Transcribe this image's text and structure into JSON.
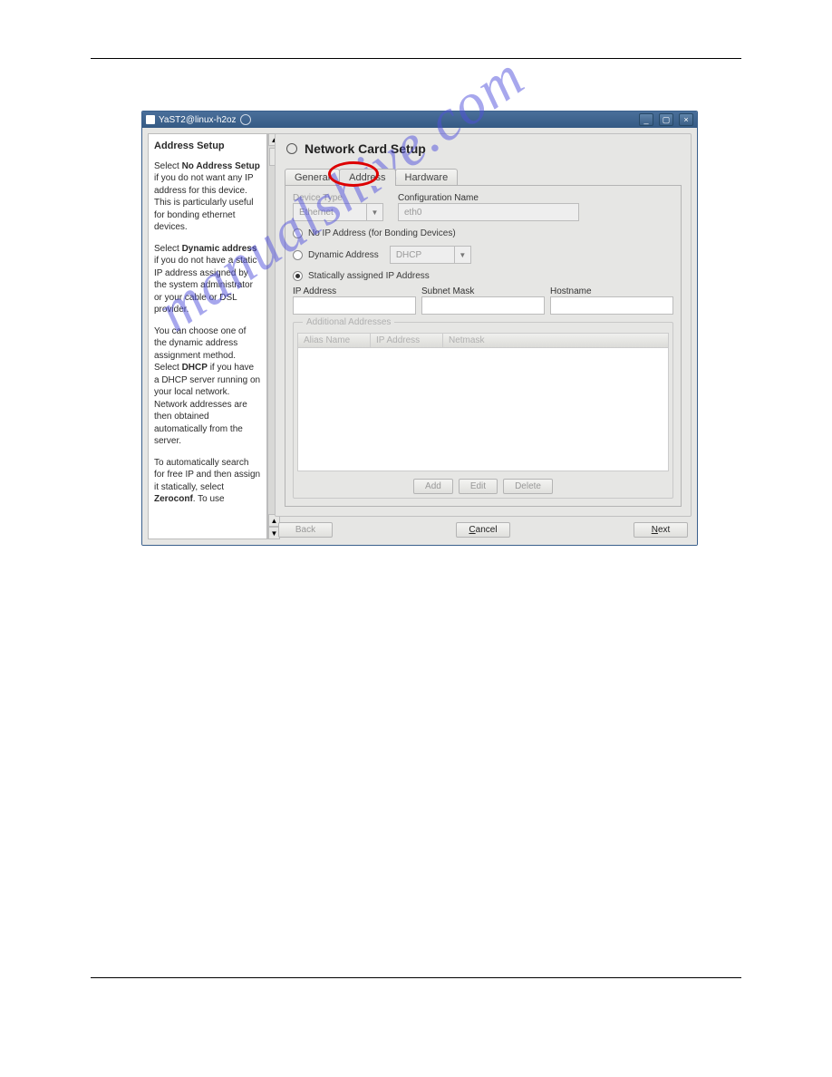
{
  "window": {
    "title": "YaST2@linux-h2oz"
  },
  "sidebar": {
    "heading": "Address Setup",
    "p1_a": "Select ",
    "p1_b": "No Address Setup",
    "p1_c": " if you do not want any IP address for this device. This is particularly useful for bonding ethernet devices.",
    "p2_a": "Select ",
    "p2_b": "Dynamic address",
    "p2_c": " if you do not have a static IP address assigned by the system administrator or your cable or DSL provider.",
    "p3_a": "You can choose one of the dynamic address assignment method. Select ",
    "p3_b": "DHCP",
    "p3_c": " if you have a DHCP server running on your local network. Network addresses are then obtained automatically from the server.",
    "p4_a": "To automatically search for free IP and then assign it statically, select ",
    "p4_b": "Zeroconf",
    "p4_c": ". To use"
  },
  "panel": {
    "title": "Network Card Setup",
    "tabs": {
      "general": "General",
      "address": "Address",
      "hardware": "Hardware"
    },
    "device_type_label": "Device Type",
    "device_type_value": "Ethernet",
    "config_name_label": "Configuration Name",
    "config_name_value": "eth0",
    "radio_noip": "No IP Address (for Bonding Devices)",
    "radio_dynamic": "Dynamic Address",
    "dynamic_value": "DHCP",
    "radio_static": "Statically assigned IP Address",
    "ip_label": "IP Address",
    "subnet_label": "Subnet Mask",
    "hostname_label": "Hostname",
    "addl_group": "Additional Addresses",
    "col_alias": "Alias Name",
    "col_ip": "IP Address",
    "col_netmask": "Netmask",
    "btn_add": "Add",
    "btn_edit": "Edit",
    "btn_delete": "Delete"
  },
  "buttons": {
    "back": "Back",
    "cancel": "Cancel",
    "next": "Next"
  },
  "watermark": "manualshive.com"
}
